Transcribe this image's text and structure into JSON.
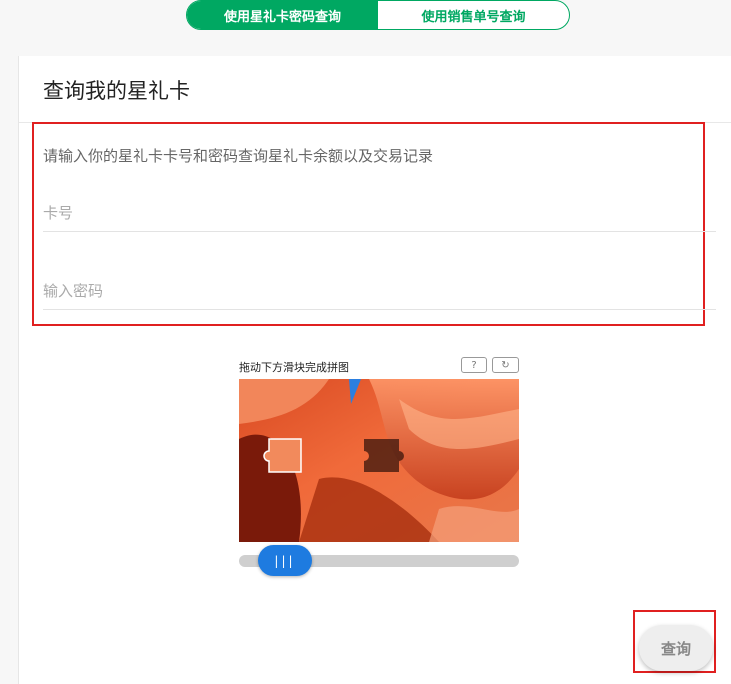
{
  "tabs": [
    {
      "label": "使用星礼卡密码查询",
      "active": true
    },
    {
      "label": "使用销售单号查询",
      "active": false
    }
  ],
  "card": {
    "title": "查询我的星礼卡",
    "description": "请输入你的星礼卡卡号和密码查询星礼卡余额以及交易记录",
    "card_number_placeholder": "卡号",
    "password_placeholder": "输入密码"
  },
  "captcha": {
    "title": "拖动下方滑块完成拼图",
    "help_icon": "?",
    "refresh_icon": "↻",
    "handle_label": "|||"
  },
  "actions": {
    "query_label": "查询"
  },
  "colors": {
    "brand": "#00a862",
    "slider": "#1e7be0",
    "highlight": "#e02020"
  }
}
